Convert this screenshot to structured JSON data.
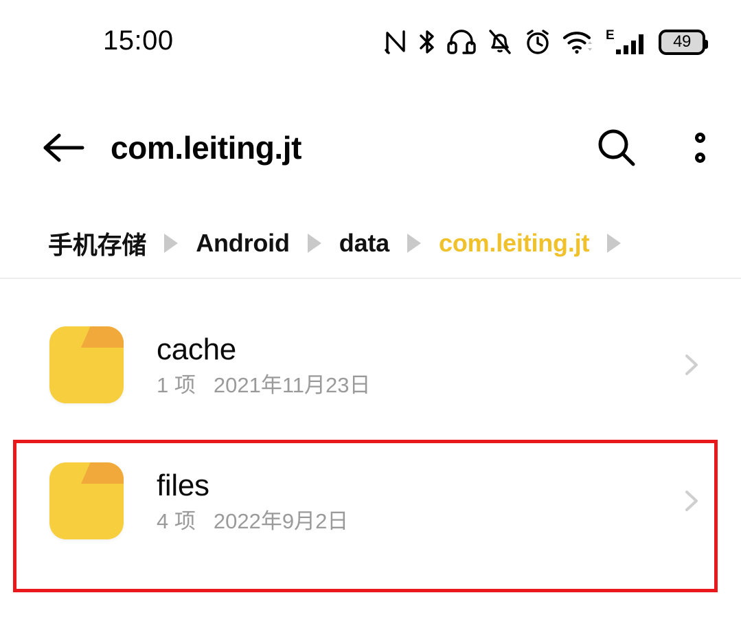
{
  "status_bar": {
    "time": "15:00",
    "battery_level": "49",
    "icons": [
      {
        "name": "nfc-icon",
        "label": "NFC"
      },
      {
        "name": "bluetooth-icon",
        "label": "Bluetooth"
      },
      {
        "name": "headset-icon",
        "label": "Headset"
      },
      {
        "name": "silent-bell-icon",
        "label": "Ringer muted"
      },
      {
        "name": "alarm-clock-icon",
        "label": "Alarm"
      },
      {
        "name": "wifi-icon",
        "label": "Wi-Fi"
      },
      {
        "name": "cellular-signal-icon",
        "label": "E"
      },
      {
        "name": "battery-icon",
        "label": "Battery"
      }
    ],
    "network_type": "E"
  },
  "app_bar": {
    "title": "com.leiting.jt",
    "back_label": "Back",
    "search_label": "Search",
    "overflow_label": "More options"
  },
  "breadcrumb": {
    "items": [
      {
        "label": "手机存储",
        "current": false
      },
      {
        "label": "Android",
        "current": false
      },
      {
        "label": "data",
        "current": false
      },
      {
        "label": "com.leiting.jt",
        "current": true
      }
    ]
  },
  "file_list": {
    "rows": [
      {
        "name": "cache",
        "item_count": "1 项",
        "date": "2021年11月23日",
        "icon": "folder-icon",
        "highlighted": false
      },
      {
        "name": "files",
        "item_count": "4 项",
        "date": "2022年9月2日",
        "icon": "folder-icon",
        "highlighted": true
      }
    ]
  },
  "colors": {
    "accent_yellow": "#F0C12B",
    "folder_yellow": "#F6CE3E",
    "folder_tab": "#F0A93A",
    "highlight_red": "#E8181B",
    "secondary_text": "#9a9a9a",
    "chevron_gray": "#cfcfcf"
  }
}
